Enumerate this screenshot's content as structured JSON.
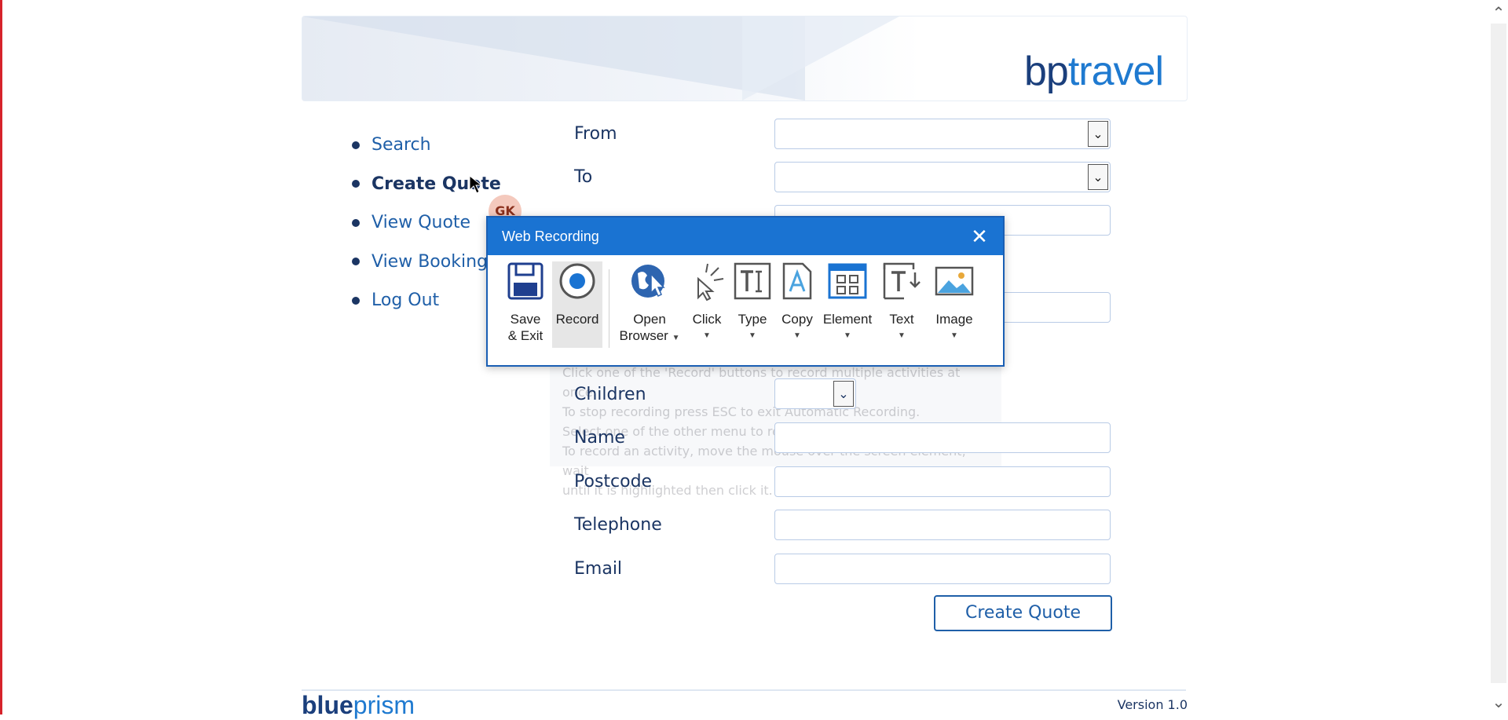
{
  "brand": {
    "bp": "bp",
    "travel": "travel"
  },
  "nav": {
    "items": [
      {
        "label": "Search"
      },
      {
        "label": "Create Quote"
      },
      {
        "label": "View Quote"
      },
      {
        "label": "View Booking"
      },
      {
        "label": "Log Out"
      }
    ]
  },
  "avatar": {
    "initials": "GK"
  },
  "form": {
    "from_label": "From",
    "to_label": "To",
    "children_label": "Children",
    "name_label": "Name",
    "postcode_label": "Postcode",
    "telephone_label": "Telephone",
    "email_label": "Email",
    "submit_label": "Create Quote"
  },
  "hint": {
    "lines": [
      "Click one of the 'Record' buttons to record multiple activities at once.",
      "To stop recording press ESC to exit Automatic Recording.",
      "Select one of the other menu to record a single activity.",
      "To record an activity, move the mouse over the screen element, wait",
      "until it is highlighted then click it."
    ]
  },
  "dialog": {
    "title": "Web Recording",
    "tools": [
      {
        "label1": "Save",
        "label2": "& Exit",
        "icon": "floppy-disk-icon"
      },
      {
        "label1": "Record",
        "label2": "",
        "icon": "record-icon"
      },
      {
        "label1": "Open",
        "label2": "Browser",
        "icon": "globe-cursor-icon"
      },
      {
        "label1": "Click",
        "label2": "",
        "icon": "click-cursor-icon"
      },
      {
        "label1": "Type",
        "label2": "",
        "icon": "type-icon"
      },
      {
        "label1": "Copy",
        "label2": "",
        "icon": "copy-icon"
      },
      {
        "label1": "Element",
        "label2": "",
        "icon": "element-icon"
      },
      {
        "label1": "Text",
        "label2": "",
        "icon": "text-icon"
      },
      {
        "label1": "Image",
        "label2": "",
        "icon": "image-icon"
      }
    ]
  },
  "footer": {
    "blue": "blue",
    "prism": "prism",
    "version": "Version 1.0"
  },
  "colors": {
    "accent": "#1a73d2",
    "nav_text": "#1f5fa8",
    "label_text": "#1b3563"
  }
}
